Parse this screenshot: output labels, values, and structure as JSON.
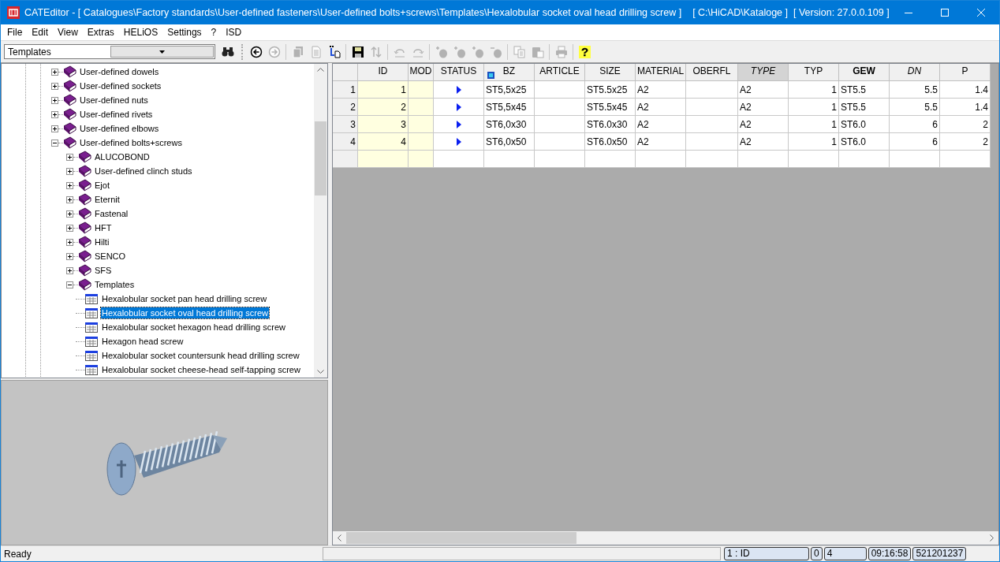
{
  "window": {
    "title": "CATEditor - [ Catalogues\\Factory standards\\User-defined fasteners\\User-defined bolts+screws\\Templates\\Hexalobular socket oval head drilling screw ]",
    "catalogue_path": "[ C:\\HiCAD\\Kataloge ]",
    "version": "[ Version: 27.0.0.109 ]"
  },
  "menu": [
    "File",
    "Edit",
    "View",
    "Extras",
    "HELiOS",
    "Settings",
    "?",
    "ISD"
  ],
  "catalogue_combo": {
    "value": "Templates"
  },
  "toolbar": [
    {
      "kind": "back",
      "disabled": false
    },
    {
      "kind": "forward",
      "disabled": true
    },
    {
      "kind": "separator"
    },
    {
      "kind": "pages",
      "disabled": true
    },
    {
      "kind": "page",
      "disabled": true
    },
    {
      "kind": "import",
      "disabled": false
    },
    {
      "kind": "separator"
    },
    {
      "kind": "save",
      "disabled": false
    },
    {
      "kind": "sort",
      "disabled": true
    },
    {
      "kind": "separator"
    },
    {
      "kind": "undo",
      "disabled": true
    },
    {
      "kind": "redo",
      "disabled": true
    },
    {
      "kind": "separator"
    },
    {
      "kind": "add",
      "disabled": true
    },
    {
      "kind": "add",
      "disabled": true
    },
    {
      "kind": "add",
      "disabled": true
    },
    {
      "kind": "remove",
      "disabled": true
    },
    {
      "kind": "separator"
    },
    {
      "kind": "copy",
      "disabled": true
    },
    {
      "kind": "paste",
      "disabled": true
    },
    {
      "kind": "separator"
    },
    {
      "kind": "print",
      "disabled": true
    },
    {
      "kind": "separator"
    },
    {
      "kind": "help",
      "disabled": false,
      "label": "?"
    }
  ],
  "tree": [
    {
      "label": "User-defined dowels",
      "kind": "folder",
      "expanded": false,
      "selected": false
    },
    {
      "label": "User-defined sockets",
      "kind": "folder",
      "expanded": false,
      "selected": false
    },
    {
      "label": "User-defined nuts",
      "kind": "folder",
      "expanded": false,
      "selected": false
    },
    {
      "label": "User-defined rivets",
      "kind": "folder",
      "expanded": false,
      "selected": false
    },
    {
      "label": "User-defined elbows",
      "kind": "folder",
      "expanded": false,
      "selected": false
    },
    {
      "label": "User-defined bolts+screws",
      "kind": "folder",
      "expanded": true,
      "selected": false,
      "children": [
        {
          "label": "ALUCOBOND",
          "kind": "folder",
          "expanded": false,
          "selected": false
        },
        {
          "label": "User-defined clinch studs",
          "kind": "folder",
          "expanded": false,
          "selected": false
        },
        {
          "label": "Ejot",
          "kind": "folder",
          "expanded": false,
          "selected": false
        },
        {
          "label": "Eternit",
          "kind": "folder",
          "expanded": false,
          "selected": false
        },
        {
          "label": "Fastenal",
          "kind": "folder",
          "expanded": false,
          "selected": false
        },
        {
          "label": "HFT",
          "kind": "folder",
          "expanded": false,
          "selected": false
        },
        {
          "label": "Hilti",
          "kind": "folder",
          "expanded": false,
          "selected": false
        },
        {
          "label": "SENCO",
          "kind": "folder",
          "expanded": false,
          "selected": false
        },
        {
          "label": "SFS",
          "kind": "folder",
          "expanded": false,
          "selected": false
        },
        {
          "label": "Templates",
          "kind": "folder",
          "expanded": true,
          "selected": false,
          "children": [
            {
              "label": "Hexalobular socket pan head drilling screw",
              "kind": "table",
              "selected": false
            },
            {
              "label": "Hexalobular socket oval head drilling screw",
              "kind": "table",
              "selected": true
            },
            {
              "label": "Hexalobular socket hexagon head drilling screw",
              "kind": "table",
              "selected": false
            },
            {
              "label": "Hexagon head screw",
              "kind": "table",
              "selected": false
            },
            {
              "label": "Hexalobular socket countersunk head drilling screw",
              "kind": "table",
              "selected": false
            },
            {
              "label": "Hexalobular socket cheese-head self-tapping screw",
              "kind": "table",
              "selected": false
            }
          ]
        }
      ]
    }
  ],
  "grid": {
    "columns": [
      {
        "label": "ID",
        "kind": "number",
        "highlighted": true,
        "selected": false
      },
      {
        "label": "MOD",
        "kind": "text",
        "highlighted": true,
        "selected": false
      },
      {
        "label": "STATUS",
        "kind": "status",
        "highlighted": false,
        "selected": false
      },
      {
        "label": "BZ",
        "kind": "text",
        "highlighted": false,
        "selected": false
      },
      {
        "label": "ARTICLE",
        "kind": "text",
        "highlighted": false,
        "selected": false
      },
      {
        "label": "SIZE",
        "kind": "text",
        "highlighted": false,
        "selected": false
      },
      {
        "label": "MATERIAL",
        "kind": "text",
        "highlighted": false,
        "selected": false
      },
      {
        "label": "OBERFL",
        "kind": "text",
        "highlighted": false,
        "selected": false
      },
      {
        "label": "TYPE",
        "kind": "text",
        "highlighted": false,
        "selected": true
      },
      {
        "label": "TYP",
        "kind": "number",
        "highlighted": false,
        "selected": false
      },
      {
        "label": "GEW",
        "kind": "text",
        "highlighted": false,
        "selected": false
      },
      {
        "label": "DN",
        "kind": "number",
        "highlighted": false,
        "selected": false
      },
      {
        "label": "P",
        "kind": "number",
        "highlighted": false,
        "selected": false
      }
    ],
    "rows": [
      {
        "number": "1",
        "cells": [
          "1",
          null,
          null,
          "ST5,5x25",
          null,
          "ST5.5x25",
          "A2",
          null,
          "A2",
          "1",
          "ST5.5",
          "5.5",
          "1.4"
        ]
      },
      {
        "number": "2",
        "cells": [
          "2",
          null,
          null,
          "ST5,5x45",
          null,
          "ST5.5x45",
          "A2",
          null,
          "A2",
          "1",
          "ST5.5",
          "5.5",
          "1.4"
        ]
      },
      {
        "number": "3",
        "cells": [
          "3",
          null,
          null,
          "ST6,0x30",
          null,
          "ST6.0x30",
          "A2",
          null,
          "A2",
          "1",
          "ST6.0",
          "6",
          "2"
        ]
      },
      {
        "number": "4",
        "cells": [
          "4",
          null,
          null,
          "ST6,0x50",
          null,
          "ST6.0x50",
          "A2",
          null,
          "A2",
          "1",
          "ST6.0",
          "6",
          "2"
        ]
      }
    ]
  },
  "status_bar": {
    "message": "Ready",
    "panels": [
      "1 : ID",
      "0",
      "4",
      "09:16:58",
      "521201237"
    ]
  }
}
